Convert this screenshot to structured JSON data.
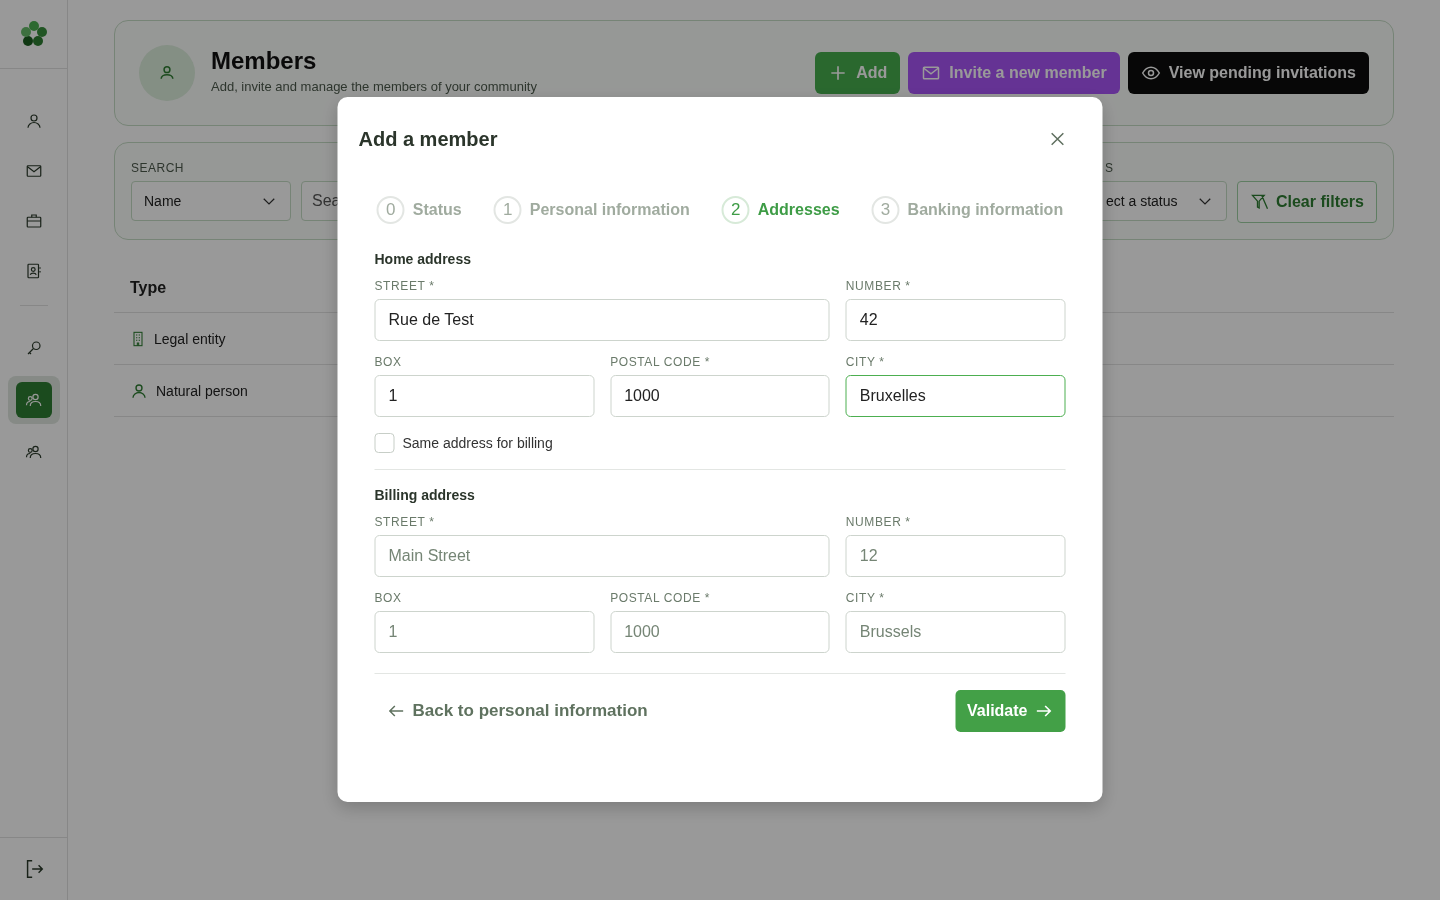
{
  "sidebar": {
    "items": [
      {
        "kind": "person",
        "selected": false
      },
      {
        "kind": "mail",
        "selected": false
      },
      {
        "kind": "briefcase",
        "selected": false
      },
      {
        "kind": "contacts",
        "selected": false
      },
      {
        "kind": "key",
        "selected": false
      },
      {
        "kind": "group",
        "selected": true
      },
      {
        "kind": "group",
        "selected": false
      }
    ]
  },
  "header": {
    "title": "Members",
    "subtitle": "Add, invite and manage the members of your community",
    "buttons": [
      {
        "label": "Add",
        "kind": "add"
      },
      {
        "label": "Invite a new member",
        "kind": "invite"
      },
      {
        "label": "View pending invitations",
        "kind": "pending"
      }
    ]
  },
  "filters": {
    "search_label": "SEARCH",
    "search_by": "Name",
    "search_placeholder": "Sea",
    "status_label": "S",
    "status_value": "ect a status",
    "clear": "Clear filters"
  },
  "table": {
    "columns": [
      "Type"
    ],
    "rows": [
      {
        "type": "Legal entity",
        "kind": "legal"
      },
      {
        "type": "Natural person",
        "kind": "natural"
      }
    ]
  },
  "modal": {
    "title": "Add a member",
    "steps": [
      {
        "number": "0",
        "label": "Status",
        "selected": false
      },
      {
        "number": "1",
        "label": "Personal information",
        "selected": false
      },
      {
        "number": "2",
        "label": "Addresses",
        "selected": true
      },
      {
        "number": "3",
        "label": "Banking information",
        "selected": false
      }
    ],
    "home_address": {
      "heading": "Home address",
      "fields": [
        {
          "label": "STREET *",
          "value": "Rue de Test",
          "focused": false
        },
        {
          "label": "NUMBER *",
          "value": "42",
          "focused": false
        },
        {
          "label": "BOX",
          "value": "1",
          "focused": false
        },
        {
          "label": "POSTAL CODE *",
          "value": "1000",
          "focused": false
        },
        {
          "label": "CITY *",
          "value": "Bruxelles",
          "focused": true
        }
      ]
    },
    "same_billing": {
      "label": "Same address for billing",
      "checked": false
    },
    "billing_address": {
      "heading": "Billing address",
      "fields": [
        {
          "label": "STREET *",
          "placeholder": "Main Street",
          "focused": false
        },
        {
          "label": "NUMBER *",
          "placeholder": "12",
          "focused": false
        },
        {
          "label": "BOX",
          "placeholder": "1",
          "focused": false
        },
        {
          "label": "POSTAL CODE *",
          "placeholder": "1000",
          "focused": false
        },
        {
          "label": "CITY *",
          "placeholder": "Brussels",
          "focused": false
        }
      ]
    },
    "back": "Back to personal information",
    "validate": "Validate"
  }
}
